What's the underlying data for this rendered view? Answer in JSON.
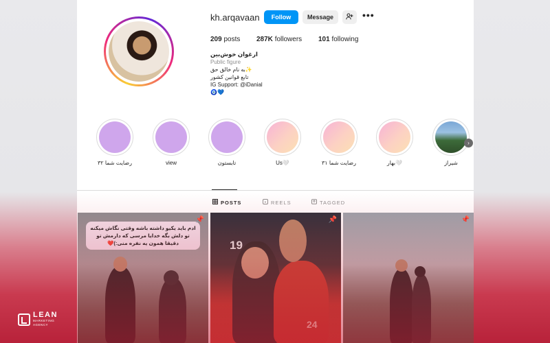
{
  "profile": {
    "username": "kh.arqavaan",
    "follow_label": "Follow",
    "message_label": "Message",
    "suggest_icon": "person-add-icon",
    "more_icon": "more-dots-icon",
    "posts_count": "209",
    "posts_label": "posts",
    "followers_count": "287K",
    "followers_label": "followers",
    "following_count": "101",
    "following_label": "following"
  },
  "bio": {
    "name": "ارغوان خوش‌بین",
    "category": "Public figure",
    "line1": "به نام خالق حق✨",
    "line2": "تابع قوانین کشور",
    "line3": "IG Support: @iDanial",
    "line4": "🧿💙"
  },
  "highlights": [
    {
      "label": "رضایت شما ۳۲",
      "style": "purple"
    },
    {
      "label": "view",
      "style": "purple"
    },
    {
      "label": "تابستون",
      "style": "purple"
    },
    {
      "label": "Us🤍",
      "style": "pink"
    },
    {
      "label": "رضایت شما ۳۱",
      "style": "pink"
    },
    {
      "label": "بهار🤍",
      "style": "pink"
    },
    {
      "label": "شیراز",
      "style": "photo"
    }
  ],
  "tabs": [
    {
      "label": "POSTS",
      "icon": "grid-icon",
      "active": true
    },
    {
      "label": "REELS",
      "icon": "reels-icon",
      "active": false
    },
    {
      "label": "TAGGED",
      "icon": "tagged-icon",
      "active": false
    }
  ],
  "posts": [
    {
      "caption": "ادم باید یکیو داشته باشه وقتی نگاش میکنه تو دلش بگه خدایا مرسی که دارمش تو دقیقا همون یه نفره منی:)❤️",
      "pinned": true
    },
    {
      "caption": "",
      "pinned": true
    },
    {
      "caption": "",
      "pinned": true
    }
  ],
  "watermark": {
    "brand": "LEAN",
    "tagline_1": "MARKETING",
    "tagline_2": "AGENCY"
  },
  "colors": {
    "follow_button": "#0095f6",
    "highlight_purple": "#cfa6ec",
    "background_gradient_bottom": "#b8223a"
  }
}
